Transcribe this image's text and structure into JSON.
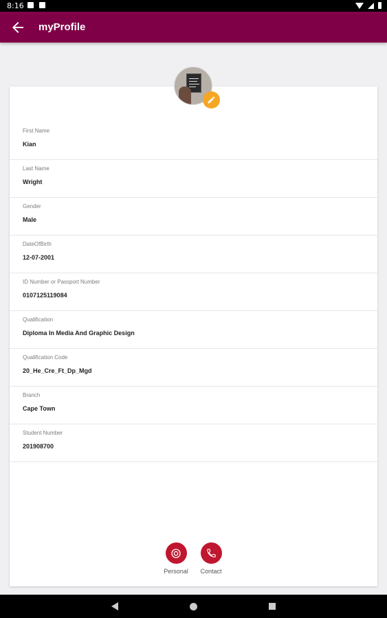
{
  "status_bar": {
    "time": "8:16"
  },
  "app_bar": {
    "title": "myProfile",
    "back_icon": "arrow-back-icon",
    "color": "#800047"
  },
  "profile": {
    "avatar_icon": "avatar-photo",
    "edit_icon": "pencil-icon",
    "edit_color": "#f5a623"
  },
  "fields": [
    {
      "label": "First Name",
      "value": "Kian"
    },
    {
      "label": "Last Name",
      "value": "Wright"
    },
    {
      "label": "Gender",
      "value": "Male"
    },
    {
      "label": "DateOfBirth",
      "value": "12-07-2001"
    },
    {
      "label": "ID Number or Passport Number",
      "value": "0107125119084"
    },
    {
      "label": "Qualification",
      "value": "Diploma In Media And Graphic Design"
    },
    {
      "label": "Qualification Code",
      "value": "20_He_Cre_Ft_Dp_Mgd"
    },
    {
      "label": "Branch",
      "value": "Cape Town"
    },
    {
      "label": "Student Number",
      "value": "201908700"
    }
  ],
  "bottom_nav": [
    {
      "label": "Personal",
      "icon": "person-circle-icon"
    },
    {
      "label": "Contact",
      "icon": "phone-icon"
    }
  ],
  "accent_color": "#c0162f"
}
